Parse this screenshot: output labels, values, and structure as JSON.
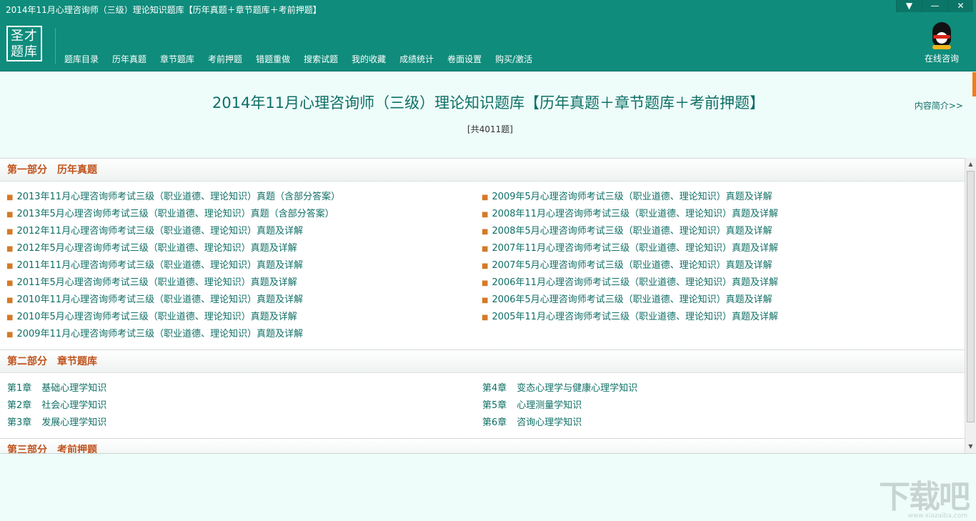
{
  "window": {
    "title": "2014年11月心理咨询师（三级）理论知识题库【历年真题＋章节题库＋考前押题】",
    "buttons": [
      "▼",
      "—",
      "✕"
    ]
  },
  "logo": {
    "line1": "圣才",
    "line2": "题库"
  },
  "nav": [
    "题库目录",
    "历年真题",
    "章节题库",
    "考前押题",
    "错题重做",
    "搜索试题",
    "我的收藏",
    "成绩统计",
    "卷面设置",
    "购买/激活"
  ],
  "consult": {
    "label": "在线咨询",
    "icon": "qq-penguin-icon"
  },
  "header": {
    "title": "2014年11月心理咨询师（三级）理论知识题库【历年真题＋章节题库＋考前押题】",
    "count": "[共4011题]",
    "intro_link": "内容简介>>"
  },
  "part1": {
    "label": "第一部分",
    "name": "历年真题",
    "left": [
      "2013年11月心理咨询师考试三级（职业道德、理论知识）真题（含部分答案）",
      "2013年5月心理咨询师考试三级（职业道德、理论知识）真题（含部分答案）",
      "2012年11月心理咨询师考试三级（职业道德、理论知识）真题及详解",
      "2012年5月心理咨询师考试三级（职业道德、理论知识）真题及详解",
      "2011年11月心理咨询师考试三级（职业道德、理论知识）真题及详解",
      "2011年5月心理咨询师考试三级（职业道德、理论知识）真题及详解",
      "2010年11月心理咨询师考试三级（职业道德、理论知识）真题及详解",
      "2010年5月心理咨询师考试三级（职业道德、理论知识）真题及详解",
      "2009年11月心理咨询师考试三级（职业道德、理论知识）真题及详解"
    ],
    "right": [
      "2009年5月心理咨询师考试三级（职业道德、理论知识）真题及详解",
      "2008年11月心理咨询师考试三级（职业道德、理论知识）真题及详解",
      "2008年5月心理咨询师考试三级（职业道德、理论知识）真题及详解",
      "2007年11月心理咨询师考试三级（职业道德、理论知识）真题及详解",
      "2007年5月心理咨询师考试三级（职业道德、理论知识）真题及详解",
      "2006年11月心理咨询师考试三级（职业道德、理论知识）真题及详解",
      "2006年5月心理咨询师考试三级（职业道德、理论知识）真题及详解",
      "2005年11月心理咨询师考试三级（职业道德、理论知识）真题及详解"
    ]
  },
  "part2": {
    "label": "第二部分",
    "name": "章节题库",
    "left": [
      {
        "num": "第1章",
        "title": "基础心理学知识"
      },
      {
        "num": "第2章",
        "title": "社会心理学知识"
      },
      {
        "num": "第3章",
        "title": "发展心理学知识"
      }
    ],
    "right": [
      {
        "num": "第4章",
        "title": "变态心理学与健康心理学知识"
      },
      {
        "num": "第5章",
        "title": "心理测量学知识"
      },
      {
        "num": "第6章",
        "title": "咨询心理学知识"
      }
    ]
  },
  "part3": {
    "label": "第三部分",
    "name": "考前押题"
  },
  "watermark": {
    "main": "下载吧",
    "sub": "www.xiazaiba.com"
  }
}
